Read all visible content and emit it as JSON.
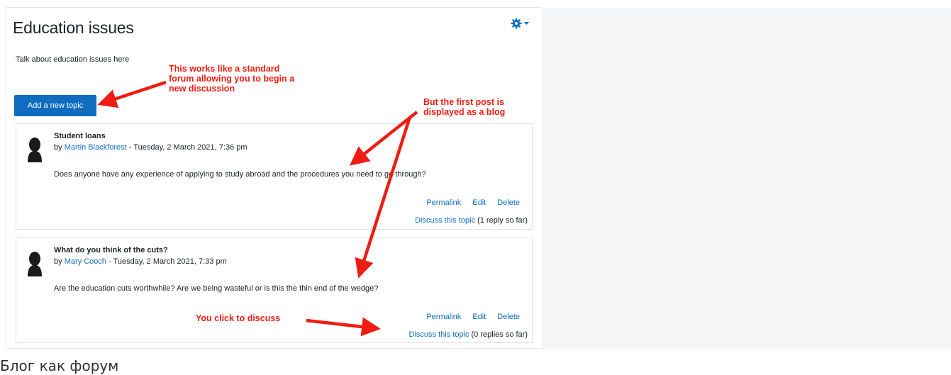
{
  "forum": {
    "title": "Education issues",
    "intro": "Talk about education issues here",
    "add_button": "Add a new topic"
  },
  "posts": [
    {
      "title": "Student loans",
      "by": "by ",
      "author": "Martin Blackforest",
      "date": " - Tuesday, 2 March 2021, 7:36 pm",
      "body": "Does anyone have any experience of applying to study abroad and the procedures you need to go through?",
      "permalink": "Permalink",
      "edit": "Edit",
      "delete": "Delete",
      "discuss": "Discuss this topic",
      "replies": "(1 reply so far)"
    },
    {
      "title": "What do you think of the cuts?",
      "by": "by ",
      "author": "Mary Cooch",
      "date": " - Tuesday, 2 March 2021, 7:33 pm",
      "body": "Are the education cuts worthwhile? Are we being wasteful or is this the thin end of the wedge?",
      "permalink": "Permalink",
      "edit": "Edit",
      "delete": "Delete",
      "discuss": "Discuss this topic",
      "replies": "(0 replies so far)"
    }
  ],
  "annotations": {
    "forum_note": "This works like a standard\nforum allowing you to begin a\nnew discussion",
    "blog_note": "But the first post is\ndisplayed as a blog",
    "discuss_note": "You click to discuss"
  },
  "caption": "Блог как форум",
  "colors": {
    "accent": "#0f6cbf",
    "annotation": "#ee1d13",
    "right_panel": "#f4f5f6"
  },
  "icons": {
    "settings": "gear-icon",
    "avatar": "user-avatar-icon"
  }
}
